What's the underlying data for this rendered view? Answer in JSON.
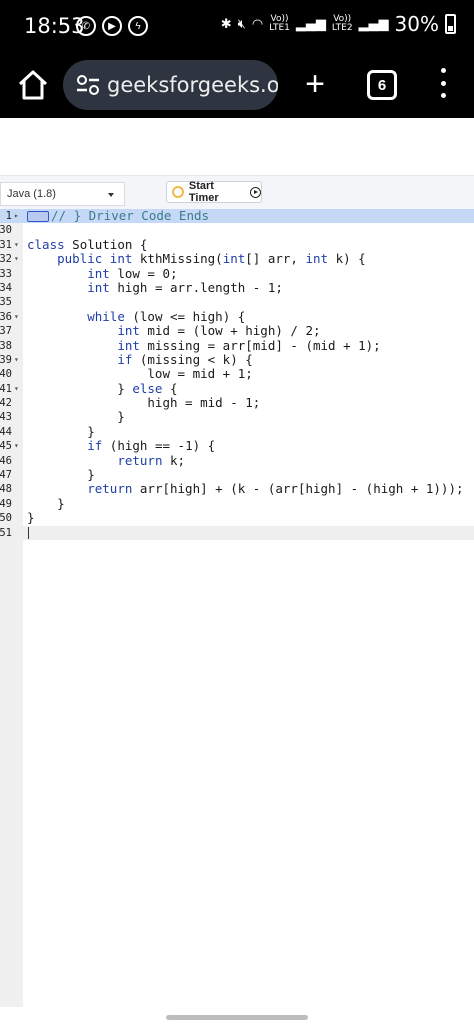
{
  "status_bar": {
    "time": "18:53",
    "net1_top": "Vo))",
    "net1_bottom": "LTE1",
    "net2_top": "Vo))",
    "net2_bottom": "LTE2",
    "battery_pct": "30%",
    "battery_level": 0.3
  },
  "browser": {
    "url": "geeksforgeeks.or",
    "tab_count": "6"
  },
  "toolbar": {
    "language": "Java (1.8)",
    "timer_label": "Start Timer"
  },
  "editor": {
    "lines": [
      {
        "num": "1",
        "fold": "▸",
        "text": "// } Driver Code Ends",
        "cls": "cm",
        "highlight": true,
        "marker": true
      },
      {
        "num": "30",
        "fold": "",
        "text": ""
      },
      {
        "num": "31",
        "fold": "▾",
        "text": "class Solution {"
      },
      {
        "num": "32",
        "fold": "▾",
        "text": "    public int kthMissing(int[] arr, int k) {"
      },
      {
        "num": "33",
        "fold": "",
        "text": "        int low = 0;"
      },
      {
        "num": "34",
        "fold": "",
        "text": "        int high = arr.length - 1;"
      },
      {
        "num": "35",
        "fold": "",
        "text": ""
      },
      {
        "num": "36",
        "fold": "▾",
        "text": "        while (low <= high) {"
      },
      {
        "num": "37",
        "fold": "",
        "text": "            int mid = (low + high) / 2;"
      },
      {
        "num": "38",
        "fold": "",
        "text": "            int missing = arr[mid] - (mid + 1);"
      },
      {
        "num": "39",
        "fold": "▾",
        "text": "            if (missing < k) {"
      },
      {
        "num": "40",
        "fold": "",
        "text": "                low = mid + 1;"
      },
      {
        "num": "41",
        "fold": "▾",
        "text": "            } else {"
      },
      {
        "num": "42",
        "fold": "",
        "text": "                high = mid - 1;"
      },
      {
        "num": "43",
        "fold": "",
        "text": "            }"
      },
      {
        "num": "44",
        "fold": "",
        "text": "        }"
      },
      {
        "num": "45",
        "fold": "▾",
        "text": "        if (high == -1) {"
      },
      {
        "num": "46",
        "fold": "",
        "text": "            return k;"
      },
      {
        "num": "47",
        "fold": "",
        "text": "        }"
      },
      {
        "num": "48",
        "fold": "",
        "text": "        return arr[high] + (k - (arr[high] - (high + 1)));"
      },
      {
        "num": "49",
        "fold": "",
        "text": "    }"
      },
      {
        "num": "50",
        "fold": "",
        "text": "}"
      },
      {
        "num": "51",
        "fold": "",
        "text": "",
        "active": true
      }
    ]
  }
}
